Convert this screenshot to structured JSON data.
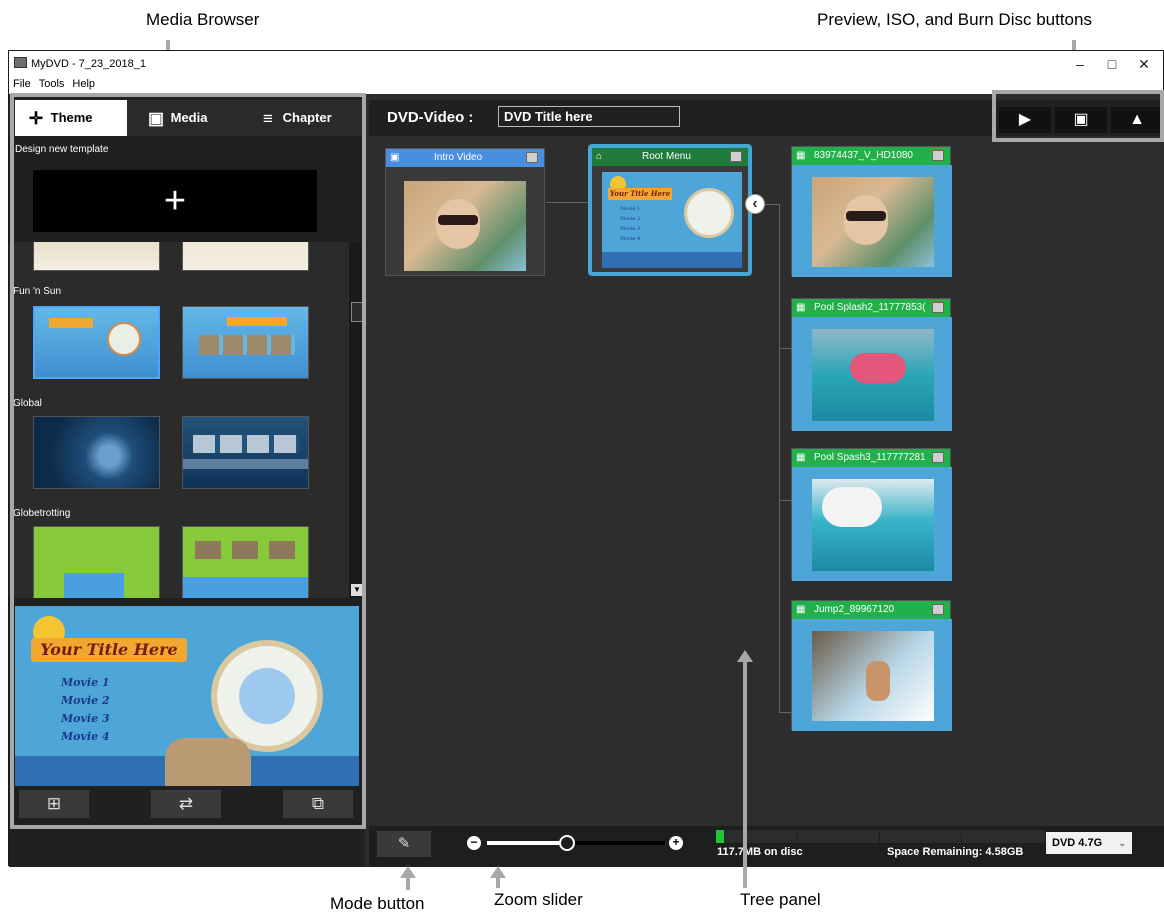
{
  "callouts": {
    "media_browser": "Media Browser",
    "preview_iso_burn": "Preview, ISO, and Burn Disc buttons",
    "mode_button": "Mode button",
    "zoom_slider": "Zoom slider",
    "tree_panel": "Tree panel"
  },
  "window": {
    "title": "MyDVD - 7_23_2018_1",
    "controls": [
      "–",
      "□",
      "✕"
    ]
  },
  "menu": [
    "File",
    "Tools",
    "Help"
  ],
  "tabs": [
    {
      "label": "Theme",
      "icon": "theme-icon",
      "glyph": "✛",
      "active": true
    },
    {
      "label": "Media",
      "icon": "media-icon",
      "glyph": "▣",
      "active": false
    },
    {
      "label": "Chapter",
      "icon": "chapter-icon",
      "glyph": "≡",
      "active": false
    }
  ],
  "theme_browser": {
    "design_label": "Design new template",
    "design_button": "+",
    "groups": [
      "Fun 'n Sun",
      "Global",
      "Globetrotting"
    ]
  },
  "preview": {
    "title": "Your Title Here",
    "movies": [
      "Movie 1",
      "Movie 2",
      "Movie 3",
      "Movie 4"
    ]
  },
  "left_buttons": {
    "add": "⊞",
    "swap": "⇄",
    "copy": "⧉"
  },
  "header": {
    "label": "DVD-Video :",
    "title_value": "DVD Title here"
  },
  "toolbar": {
    "preview": "▶",
    "iso": "▣",
    "burn": "▲"
  },
  "tree": {
    "intro": {
      "label": "Intro Video",
      "color": "#4a8ee0"
    },
    "root": {
      "label": "Root Menu",
      "color": "#1f7a3c",
      "title": "Your Title Here",
      "movies": [
        "Movie 1",
        "Movie 2",
        "Movie 3",
        "Movie 4"
      ]
    },
    "collapse": "‹",
    "children": [
      {
        "label": "83974437_V_HD1080"
      },
      {
        "label": "Pool Splash2_11777853("
      },
      {
        "label": "Pool Spash3_117777281"
      },
      {
        "label": "Jump2_89967120"
      }
    ],
    "child_color": "#22b04a"
  },
  "bottom": {
    "mode": "✎",
    "zoom_minus": "−",
    "zoom_plus": "+",
    "zoom_level": 0.45,
    "used": "117.7MB on disc",
    "remaining": "Space Remaining: 4.58GB",
    "disc_type": "DVD 4.7G",
    "capacity_used_fraction": 0.025
  }
}
